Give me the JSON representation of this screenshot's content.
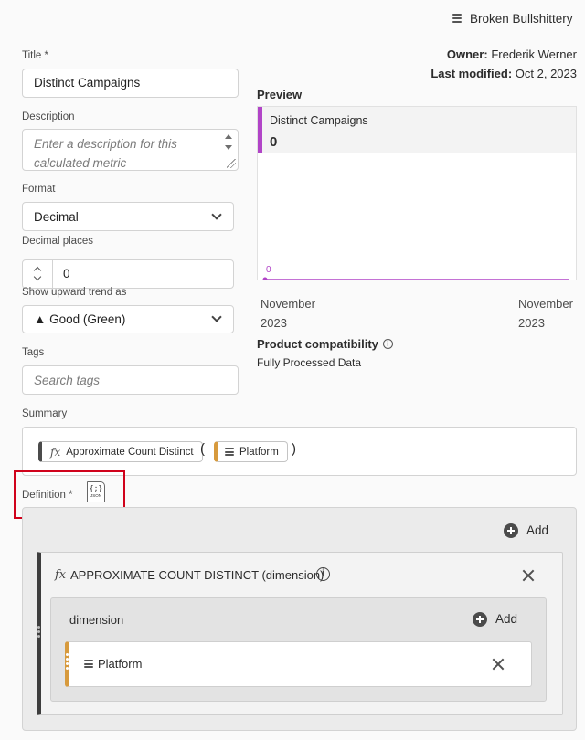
{
  "top": {
    "workspace_name": "Broken Bullshittery",
    "owner_label": "Owner:",
    "owner_name": "Frederik Werner",
    "modified_label": "Last modified:",
    "modified_date": "Oct 2, 2023"
  },
  "form": {
    "title_label": "Title",
    "title_value": "Distinct Campaigns",
    "description_label": "Description",
    "description_placeholder": "Enter a description for this calculated metric",
    "format_label": "Format",
    "format_value": "Decimal",
    "decimal_label": "Decimal places",
    "decimal_value": "0",
    "trend_label": "Show upward trend as",
    "trend_value": "▲ Good (Green)",
    "tags_label": "Tags",
    "tags_placeholder": "Search tags",
    "required_mark": "*"
  },
  "preview": {
    "heading": "Preview",
    "metric_name": "Distinct Campaigns",
    "metric_total": "0",
    "chart_zero_label": "0",
    "accent_color": "#b144c7",
    "x_start": {
      "month": "November",
      "year": "2023"
    },
    "x_end": {
      "month": "November",
      "year": "2023"
    },
    "compat_label": "Product compatibility",
    "compat_value": "Fully Processed Data"
  },
  "chart_data": {
    "type": "line",
    "series": [
      {
        "name": "Distinct Campaigns",
        "values": [
          0,
          0
        ]
      }
    ],
    "categories": [
      "November 2023",
      "November 2023"
    ]
  },
  "summary": {
    "label": "Summary",
    "func_chip": "Approximate Count Distinct",
    "func_icon": "fx",
    "open_paren": "(",
    "dim_chip": "Platform",
    "close_paren": ")",
    "func_color": "#4b4b4b",
    "dim_color": "#d79a3d"
  },
  "definition": {
    "label": "Definition",
    "json_icon_text": "{;}",
    "json_icon_caption": "JSON",
    "add_label": "Add",
    "func_title": "APPROXIMATE COUNT DISTINCT (dimension)",
    "func_icon": "fx",
    "param_label": "dimension",
    "param_add_label": "Add",
    "dim_name": "Platform",
    "highlight_color": "#d0021b"
  }
}
